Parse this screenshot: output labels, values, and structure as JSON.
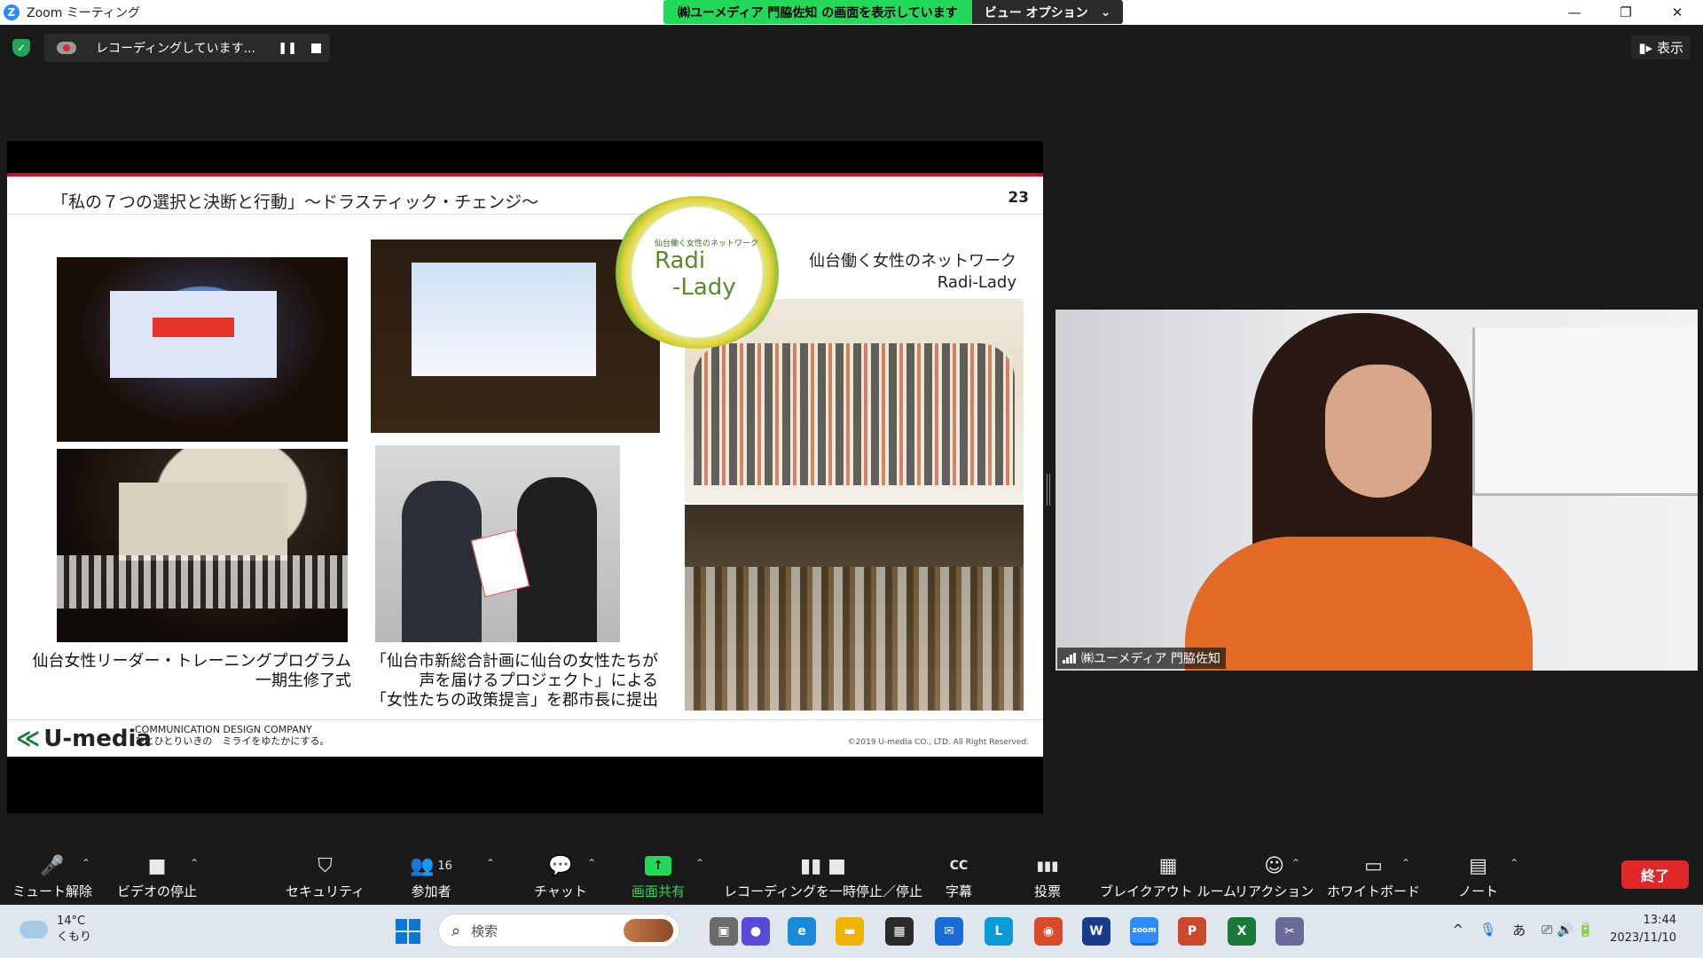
{
  "window": {
    "title": "Zoom ミーティング",
    "share_banner": "㈱ユーメディア 門脇佐知 の画面を表示しています",
    "view_options": "ビュー オプション",
    "view_options_caret": "⌄",
    "minimize": "—",
    "maximize": "❐",
    "close": "✕"
  },
  "meeting": {
    "recording_text": "レコーディングしています...",
    "pause_glyph": "❚❚",
    "view_button": "表示",
    "view_button_icon": "▮▸"
  },
  "slide": {
    "title": "「私の７つの選択と決断と行動」〜ドラスティック・チェンジ〜",
    "page_number": "23",
    "network_title_line1": "仙台働く女性のネットワーク",
    "network_title_line2": "Radi-Lady",
    "logo_small": "仙台働く女性のネットワーク",
    "logo_line1": "Radi",
    "logo_line2": "-Lady",
    "caption_left_line1": "仙台女性リーダー・トレーニングプログラム",
    "caption_left_line2": "一期生修了式",
    "caption_mid_line1": "「仙台市新総合計画に仙台の女性たちが",
    "caption_mid_line2": "声を届けるプロジェクト」による",
    "caption_mid_line3": "「女性たちの政策提言」を郡市長に提出",
    "footer_brand": "U-media",
    "footer_brand_mark": "≪",
    "footer_tagline1": "COMMUNICATION DESIGN COMPANY",
    "footer_tagline2": "ひとひとりいきの　ミライをゆたかにする。",
    "copyright": "©2019 U-media CO., LTD. All Right Reserved."
  },
  "participant": {
    "name": "㈱ユーメディア 門脇佐知"
  },
  "toolbar": {
    "caret": "⌃",
    "items": [
      {
        "label": "ミュート解除",
        "icon": "🎤"
      },
      {
        "label": "ビデオの停止",
        "icon": "■"
      },
      {
        "label": "セキュリティ",
        "icon": "⛉"
      },
      {
        "label": "参加者",
        "icon": "👥",
        "count": "16"
      },
      {
        "label": "チャット",
        "icon": "💬"
      },
      {
        "label": "画面共有",
        "icon": "↑"
      },
      {
        "label": "レコーディングを一時停止／停止",
        "icon": "▮▮ ■"
      },
      {
        "label": "字幕",
        "icon": "CC"
      },
      {
        "label": "投票",
        "icon": "▮▮▮"
      },
      {
        "label": "ブレイクアウト ルーム",
        "icon": "▦"
      },
      {
        "label": "リアクション",
        "icon": "☺"
      },
      {
        "label": "ホワイトボード",
        "icon": "▭"
      },
      {
        "label": "ノート",
        "icon": "▤"
      }
    ],
    "end_label": "終了"
  },
  "taskbar": {
    "temperature": "14°C",
    "weather": "くもり",
    "search_placeholder": "検索",
    "search_icon": "⌕",
    "chevron": "^",
    "mic_icon": "🎙",
    "ime": "あ",
    "tray_icons": "⎚ 🔊 🔋",
    "time": "13:44",
    "date": "2023/11/10",
    "apps": [
      {
        "name": "task-view",
        "glyph": "▣",
        "color": "#6a6a6a"
      },
      {
        "name": "zoom-chat",
        "glyph": "●",
        "color": "#5a4ad8"
      },
      {
        "name": "edge",
        "glyph": "e",
        "color": "#1a8ad8"
      },
      {
        "name": "explorer",
        "glyph": "▬",
        "color": "#f0b400"
      },
      {
        "name": "store",
        "glyph": "▦",
        "color": "#2a2a2a"
      },
      {
        "name": "mail",
        "glyph": "✉",
        "color": "#1a6ad8"
      },
      {
        "name": "l-app",
        "glyph": "L",
        "color": "#0a9ad8"
      },
      {
        "name": "chrome",
        "glyph": "◉",
        "color": "#d84a2a"
      },
      {
        "name": "w-app",
        "glyph": "W",
        "color": "#1a3a8a"
      },
      {
        "name": "zoom",
        "glyph": "zoom",
        "color": "#2d8cff"
      },
      {
        "name": "powerpoint",
        "glyph": "P",
        "color": "#c84a2a"
      },
      {
        "name": "excel",
        "glyph": "X",
        "color": "#1a7a3a"
      },
      {
        "name": "snipping",
        "glyph": "✂",
        "color": "#6a6a9a"
      }
    ]
  }
}
